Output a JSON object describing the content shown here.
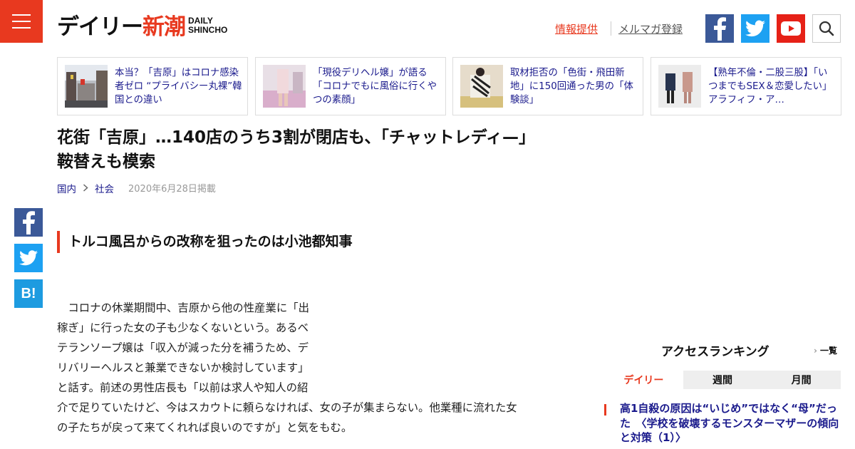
{
  "header": {
    "logo_jp_a": "デイリー",
    "logo_jp_b": "新潮",
    "logo_en_1": "DAILY",
    "logo_en_2": "SHINCHO",
    "link_info": "情報提供",
    "link_mail": "メルマガ登録",
    "icons": [
      "menu-icon",
      "facebook-icon",
      "twitter-icon",
      "youtube-icon",
      "search-icon"
    ]
  },
  "related": [
    {
      "title": "本当？「吉原」はコロナ感染者ゼロ “プライバシー丸裸”韓国との違い"
    },
    {
      "title": "「現役デリヘル嬢」が語る「コロナでもに風俗に行くやつの素顔」"
    },
    {
      "title": "取材拒否の「色街・飛田新地」に150回通った男の「体験談」"
    },
    {
      "title": "【熟年不倫・二股三股】「いつまでもSEX＆恋愛したい」アラフィフ・ア…"
    }
  ],
  "article": {
    "title": "花街「吉原」…140店のうち3割が閉店も、「チャットレディ—」鞍替えも模索",
    "crumb1": "国内",
    "crumb2": "社会",
    "date": "2020年6月28日掲載",
    "subheading": "トルコ風呂からの改称を狙ったのは小池都知事",
    "body_lines": [
      "コロナの休業期間中、吉原から他の性産業に「出",
      "稼ぎ」に行った女の子も少なくないという。あるベ",
      "テランソープ嬢は「収入が減った分を補うため、デ",
      "リバリーヘルスと兼業できないか検討しています」",
      "と話す。前述の男性店長も「以前は求人や知人の紹",
      "介で足りていたけど、今はスカウトに頼らなければ、女の子が集まらない。他業種に流れた女",
      "の子たちが戻って来てくれれば良いのですが」と気をもむ。"
    ]
  },
  "share": {
    "hatena_label": "B!"
  },
  "ranking": {
    "title": "アクセスランキング",
    "all_link": "一覧",
    "tabs": [
      "デイリー",
      "週間",
      "月間"
    ],
    "first_item": "高1自殺の原因は“いじめ”ではなく“母”だった　〈学校を破壊するモンスターマザーの傾向と対策（1）〉"
  },
  "colors": {
    "accent": "#e8391f",
    "link": "#1a1a8c",
    "facebook": "#3b5998",
    "twitter": "#1da1f2",
    "youtube": "#e62117"
  }
}
